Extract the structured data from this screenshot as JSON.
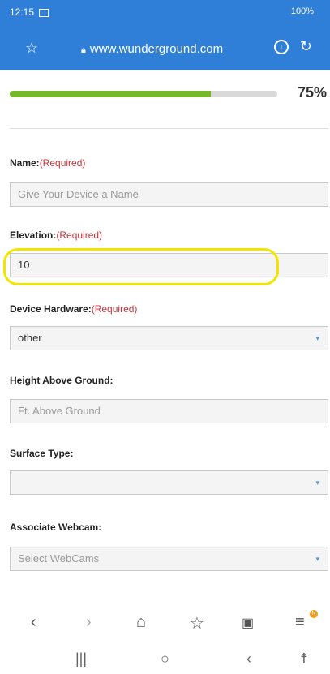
{
  "status": {
    "time": "12:15",
    "right": "100%"
  },
  "browser": {
    "url": "www.wunderground.com"
  },
  "progress": {
    "percent": 75,
    "label": "75%"
  },
  "form": {
    "name": {
      "label": "Name:",
      "req": "(Required)",
      "placeholder": "Give Your Device a Name"
    },
    "elevation": {
      "label": "Elevation:",
      "req": "(Required)",
      "value": "10"
    },
    "hardware": {
      "label": "Device Hardware:",
      "req": "(Required)",
      "value": "other"
    },
    "height": {
      "label": "Height Above Ground:",
      "placeholder": "Ft. Above Ground"
    },
    "surface": {
      "label": "Surface Type:",
      "value": ""
    },
    "webcam": {
      "label": "Associate Webcam:",
      "placeholder": "Select WebCams"
    }
  },
  "nav": {
    "badge": "N"
  },
  "colors": {
    "browser_bar": "#2f7fd9",
    "progress": "#76b82a",
    "required": "#c8323a",
    "highlight": "#f2e600"
  },
  "icons": [
    "star-icon",
    "lock-icon",
    "download-icon",
    "reload-icon",
    "back-icon",
    "forward-icon",
    "home-icon",
    "bookmark-icon",
    "tabs-icon",
    "menu-icon"
  ]
}
